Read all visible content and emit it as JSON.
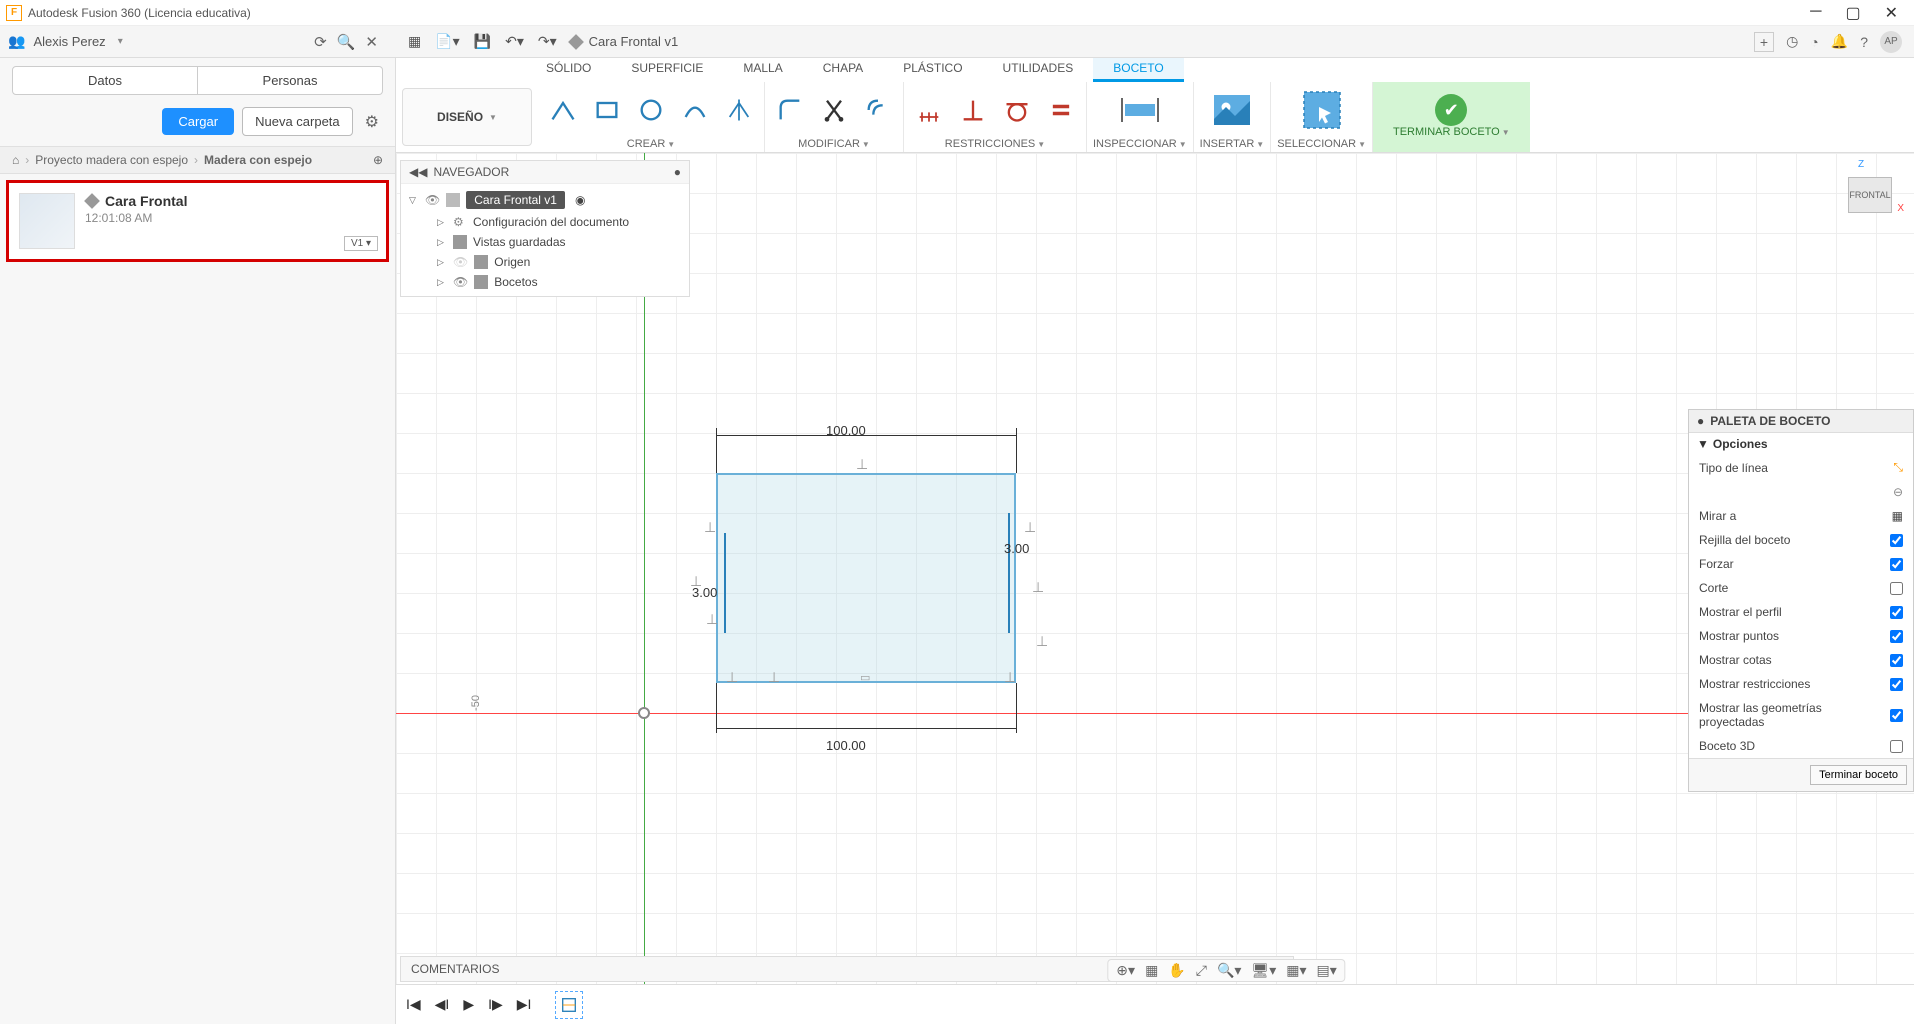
{
  "title_bar": {
    "text": "Autodesk Fusion 360 (Licencia educativa)"
  },
  "user_bar": {
    "user_name": "Alexis Perez",
    "doc_title": "Cara Frontal v1",
    "avatar": "AP"
  },
  "data_panel": {
    "tabs": {
      "data": "Datos",
      "people": "Personas"
    },
    "upload_btn": "Cargar",
    "new_folder_btn": "Nueva carpeta",
    "breadcrumb": {
      "project": "Proyecto madera con espejo",
      "folder": "Madera con espejo"
    },
    "file": {
      "name": "Cara Frontal",
      "time": "12:01:08 AM",
      "version": "V1 ▾"
    }
  },
  "ribbon": {
    "design_label": "DISEÑO",
    "tabs": {
      "solid": "SÓLIDO",
      "surface": "SUPERFICIE",
      "mesh": "MALLA",
      "sheet": "CHAPA",
      "plastic": "PLÁSTICO",
      "utilities": "UTILIDADES",
      "sketch": "BOCETO"
    },
    "groups": {
      "create": "CREAR",
      "modify": "MODIFICAR",
      "constraints": "RESTRICCIONES",
      "inspect": "INSPECCIONAR",
      "insert": "INSERTAR",
      "select": "SELECCIONAR",
      "finish": "TERMINAR BOCETO"
    }
  },
  "browser": {
    "title": "NAVEGADOR",
    "root": "Cara Frontal v1",
    "items": {
      "doc_config": "Configuración del documento",
      "saved_views": "Vistas guardadas",
      "origin": "Origen",
      "sketches": "Bocetos"
    }
  },
  "canvas": {
    "dim_100_a": "100.00",
    "dim_100_b": "100.00",
    "dim_3_a": "3.00",
    "dim_3_b": "3.00",
    "tick_50": "-50"
  },
  "view_cube": {
    "face": "FRONTAL",
    "z": "Z",
    "x": "X"
  },
  "palette": {
    "title": "PALETA DE BOCETO",
    "section": "Opciones",
    "rows": {
      "line_type": "Tipo de línea",
      "look_at": "Mirar a",
      "grid": "Rejilla del boceto",
      "snap": "Forzar",
      "slice": "Corte",
      "profile": "Mostrar el perfil",
      "points": "Mostrar puntos",
      "dims": "Mostrar cotas",
      "constraints": "Mostrar restricciones",
      "projected": "Mostrar las geometrías proyectadas",
      "sketch3d": "Boceto 3D"
    },
    "finish_btn": "Terminar boceto"
  },
  "comments": {
    "label": "COMENTARIOS"
  }
}
